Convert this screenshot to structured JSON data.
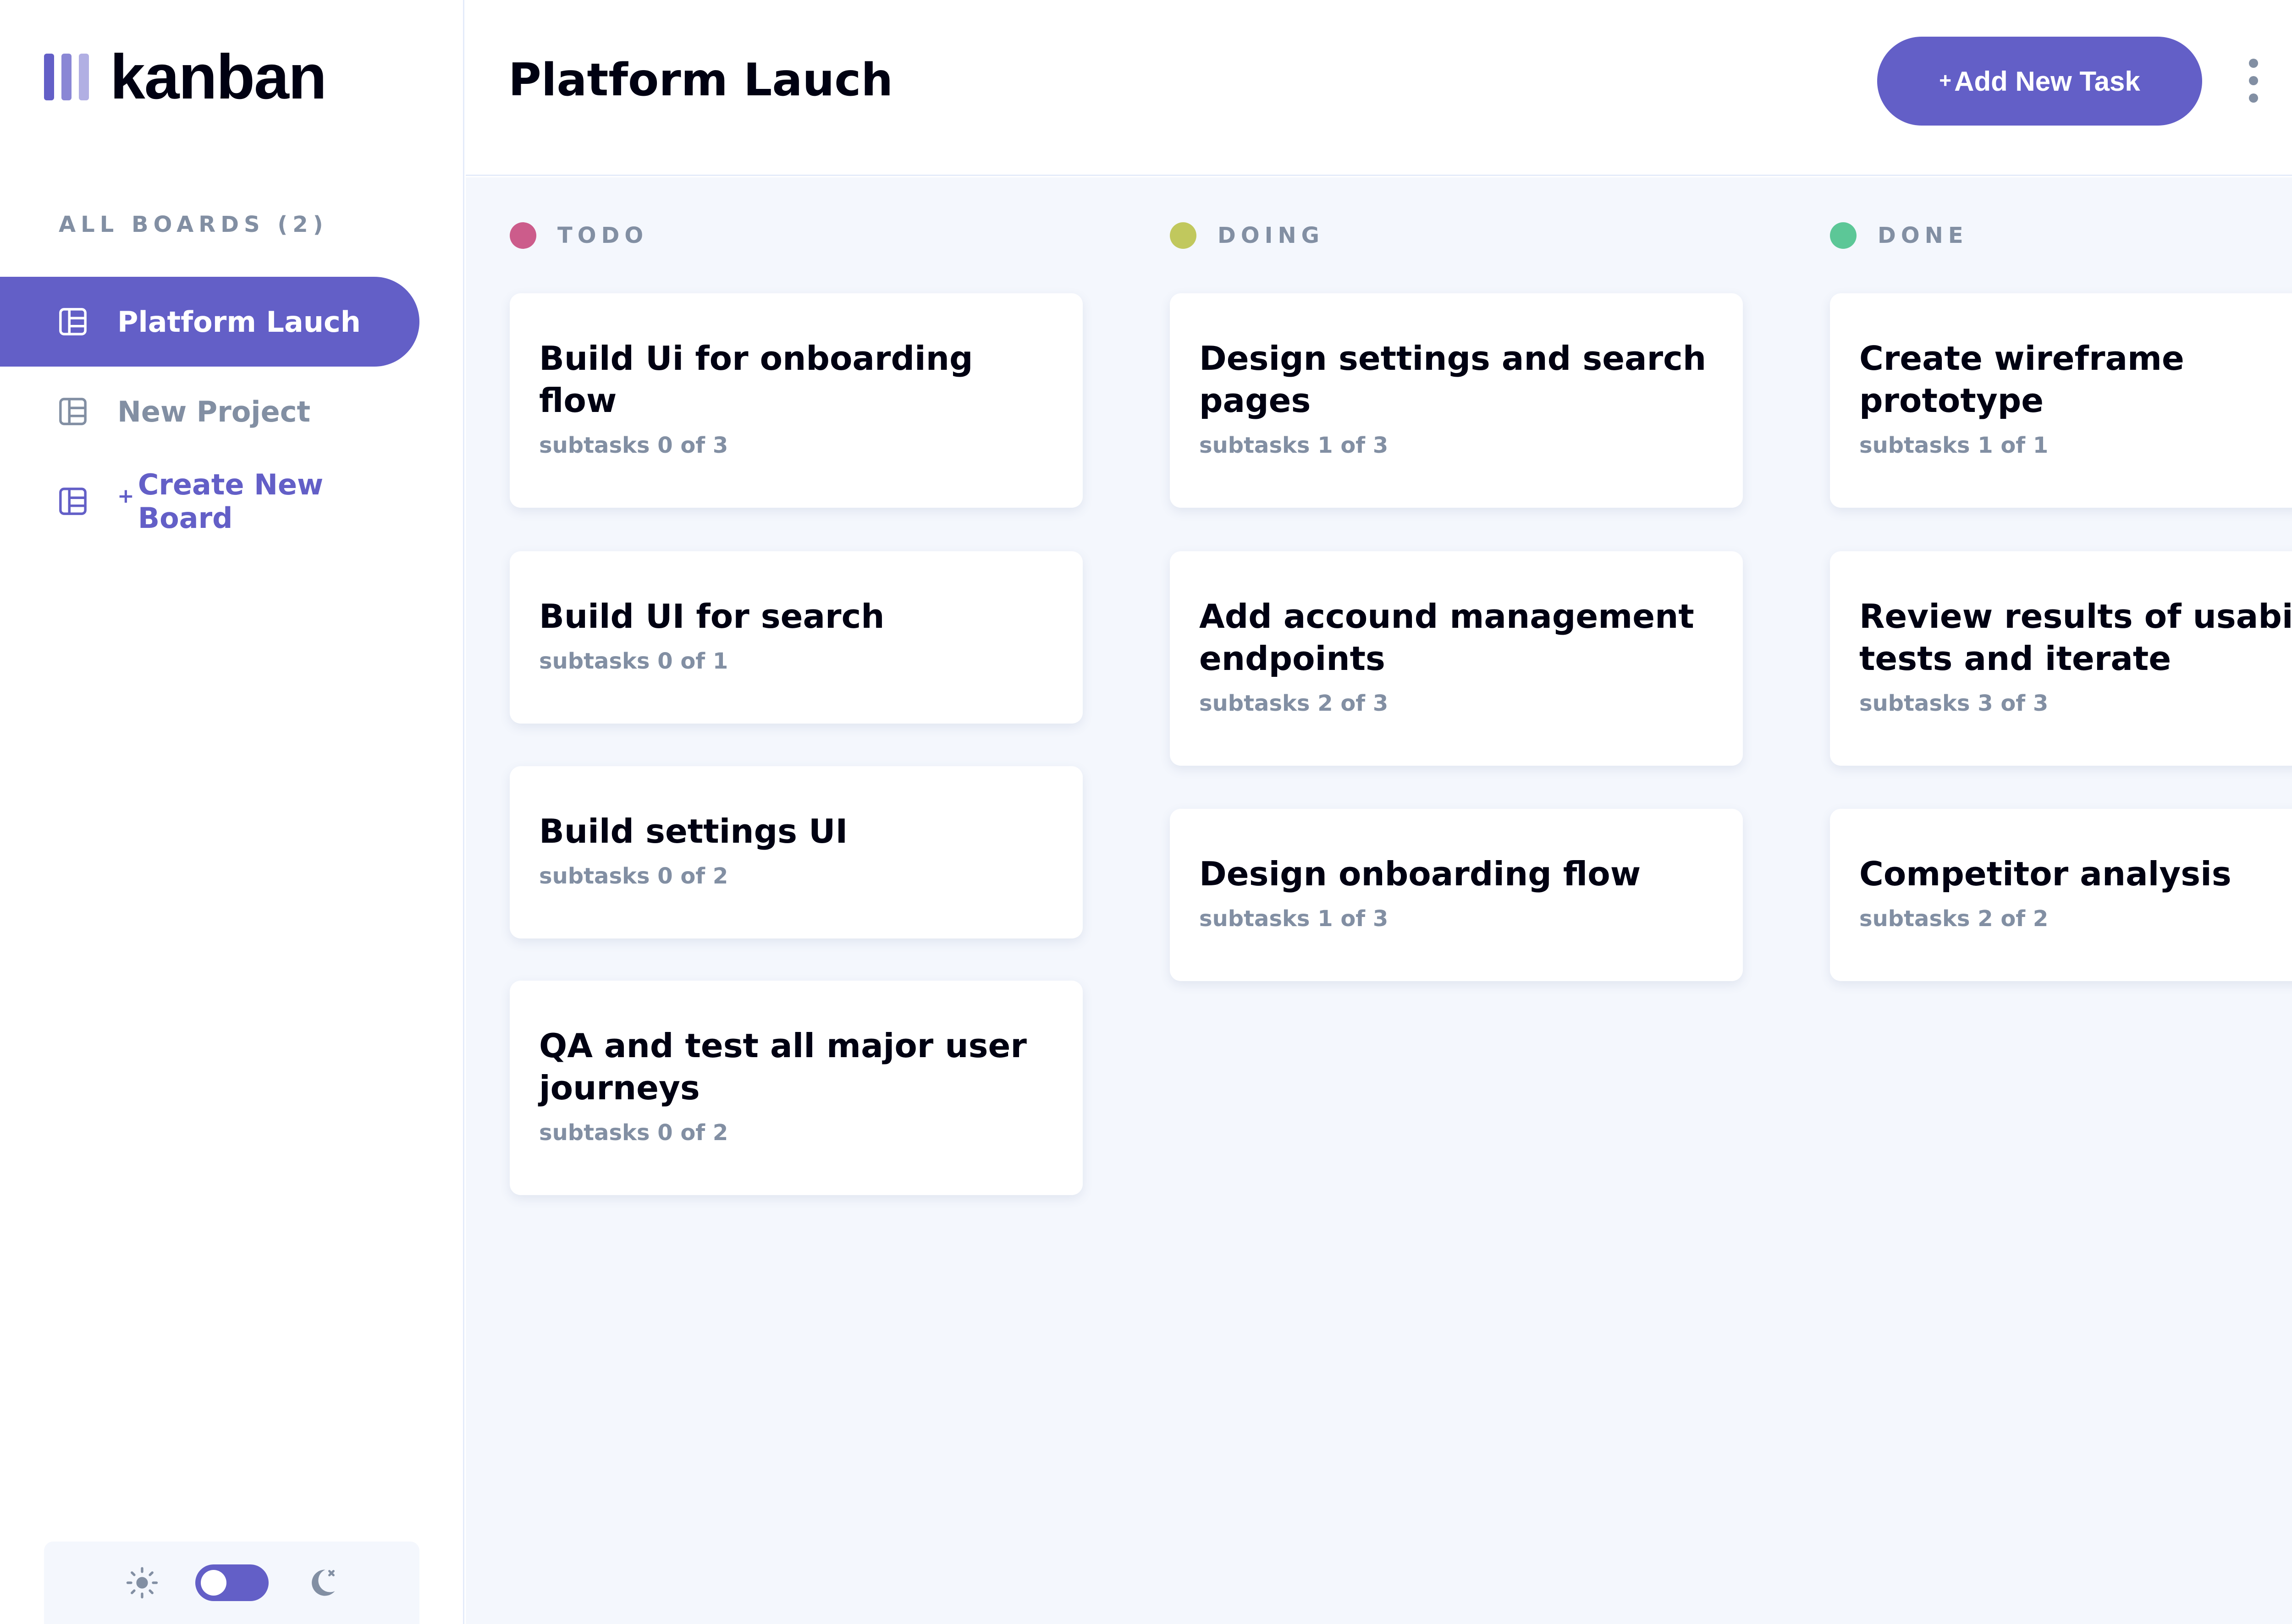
{
  "app": {
    "logo_text": "kanban"
  },
  "sidebar": {
    "heading": "ALL BOARDS (2)",
    "boards": [
      {
        "label": "Platform Lauch",
        "active": true
      },
      {
        "label": "New Project",
        "active": false
      }
    ],
    "create_plus": "+",
    "create_label": "Create New Board",
    "theme": {
      "light_icon": "sun-icon",
      "dark_icon": "moon-icon",
      "dark_mode": true
    }
  },
  "header": {
    "title": "Platform Lauch",
    "add_plus": "+",
    "add_label": "Add New Task",
    "menu_icon": "kebab-menu-icon"
  },
  "colors": {
    "accent": "#635fc7",
    "todo": "#cc5c8b",
    "doing": "#c1c85d",
    "done": "#5cc797",
    "muted": "#828fa3",
    "board_bg": "#f4f7fd"
  },
  "columns": [
    {
      "name": "TODO",
      "dot_color": "#cc5c8b",
      "tasks": [
        {
          "title": "Build Ui for onboarding flow",
          "subtasks": "subtasks 0 of 3"
        },
        {
          "title": "Build UI for search",
          "subtasks": "subtasks 0 of 1"
        },
        {
          "title": "Build settings UI",
          "subtasks": "subtasks 0 of 2"
        },
        {
          "title": "QA and test all major user journeys",
          "subtasks": "subtasks 0 of 2"
        }
      ]
    },
    {
      "name": "DOING",
      "dot_color": "#c1c85d",
      "tasks": [
        {
          "title": "Design settings and search pages",
          "subtasks": "subtasks 1 of 3"
        },
        {
          "title": "Add accound management endpoints",
          "subtasks": "subtasks 2 of 3"
        },
        {
          "title": "Design onboarding flow",
          "subtasks": "subtasks 1 of 3"
        }
      ]
    },
    {
      "name": "DONE",
      "dot_color": "#5cc797",
      "tasks": [
        {
          "title": "Create wireframe prototype",
          "subtasks": "subtasks 1 of 1"
        },
        {
          "title": "Review results of usability tests and iterate",
          "subtasks": "subtasks 3 of 3"
        },
        {
          "title": "Competitor analysis",
          "subtasks": "subtasks 2 of 2"
        }
      ]
    }
  ]
}
